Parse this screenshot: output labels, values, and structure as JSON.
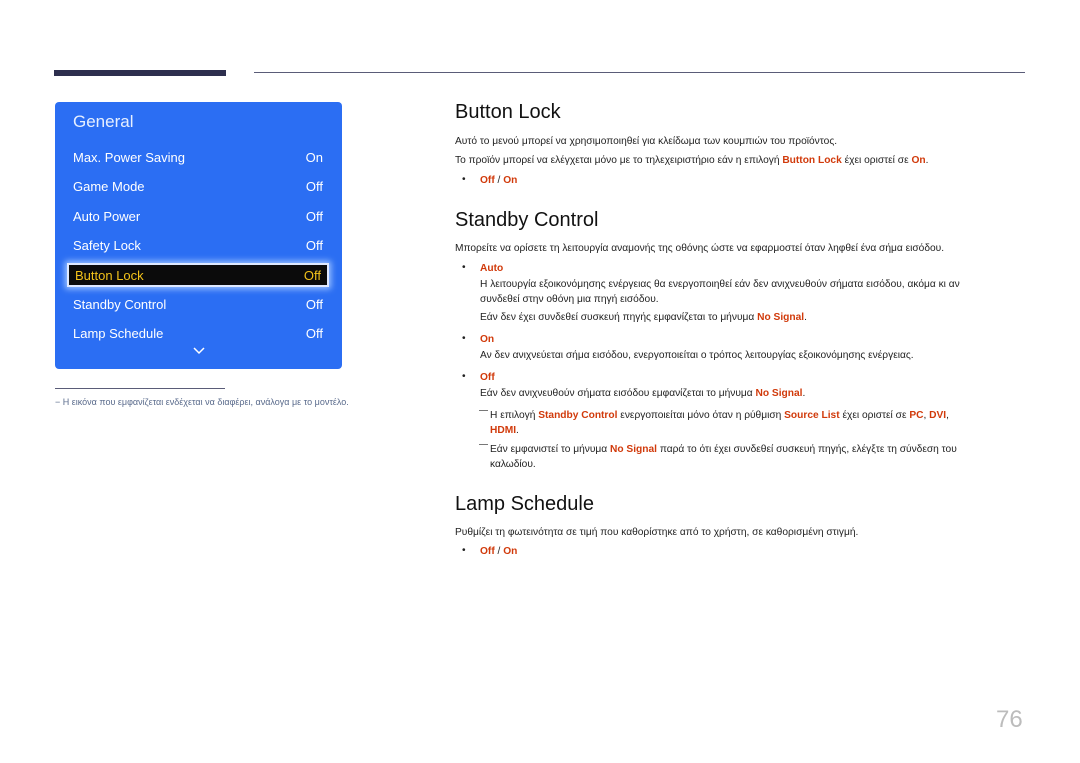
{
  "osd": {
    "title": "General",
    "items": [
      {
        "label": "Max. Power Saving",
        "value": "On"
      },
      {
        "label": "Game Mode",
        "value": "Off"
      },
      {
        "label": "Auto Power",
        "value": "Off"
      },
      {
        "label": "Safety Lock",
        "value": "Off"
      },
      {
        "label": "Button Lock",
        "value": "Off",
        "selected": true
      },
      {
        "label": "Standby Control",
        "value": "Off"
      },
      {
        "label": "Lamp Schedule",
        "value": "Off"
      }
    ],
    "more_icon": "chevron-down-icon",
    "colors": {
      "background": "#2b6ef3",
      "selected_text": "#f2c21a",
      "selected_bg": "#0b0b0b"
    }
  },
  "footnote": "− Η εικόνα που εμφανίζεται ενδέχεται να διαφέρει, ανάλογα με το μοντέλο.",
  "button_lock": {
    "heading": "Button Lock",
    "p1": "Αυτό το μενού μπορεί να χρησιμοποιηθεί για κλείδωμα των κουμπιών του προϊόντος.",
    "p2_before": "Το προϊόν μπορεί να ελέγχεται μόνο με το τηλεχειριστήριο εάν η επιλογή ",
    "p2_hl1": "Button Lock",
    "p2_mid": " έχει οριστεί σε ",
    "p2_hl2": "On",
    "p2_end": ".",
    "options": {
      "a": "Off",
      "sep": " / ",
      "b": "On"
    }
  },
  "standby_control": {
    "heading": "Standby Control",
    "intro": "Μπορείτε να ορίσετε τη λειτουργία αναμονής της οθόνης ώστε να εφαρμοστεί όταν ληφθεί ένα σήμα εισόδου.",
    "auto_label": "Auto",
    "auto_line1": "Η λειτουργία εξοικονόμησης ενέργειας θα ενεργοποιηθεί εάν δεν ανιχνευθούν σήματα εισόδου, ακόμα κι αν",
    "auto_line2": "συνδεθεί στην οθόνη μια πηγή εισόδου.",
    "auto_line3_before": "Εάν δεν έχει συνδεθεί συσκευή πηγής εμφανίζεται το μήνυμα ",
    "auto_line3_hl": "No Signal",
    "auto_line3_end": ".",
    "on_label": "On",
    "on_text": "Αν δεν ανιχνεύεται σήμα εισόδου, ενεργοποιείται ο τρόπος λειτουργίας εξοικονόμησης ενέργειας.",
    "off_label": "Off",
    "off_text_before": "Εάν δεν ανιχνευθούν σήματα εισόδου εμφανίζεται το μήνυμα ",
    "off_text_hl": "No Signal",
    "off_text_end": ".",
    "note1": {
      "t1": "Η επιλογή ",
      "h1": "Standby Control",
      "t2": " ενεργοποιείται μόνο όταν η ρύθμιση ",
      "h2": "Source List",
      "t3": " έχει οριστεί σε ",
      "h3": "PC",
      "t4": ", ",
      "h4": "DVI",
      "t5": ",",
      "h5": "HDMI",
      "t6": "."
    },
    "note2": {
      "t1": "Εάν εμφανιστεί το μήνυμα ",
      "h1": "No Signal",
      "t2": " παρά το ότι έχει συνδεθεί συσκευή πηγής, ελέγξτε τη σύνδεση του",
      "line2": "καλωδίου."
    }
  },
  "lamp_schedule": {
    "heading": "Lamp Schedule",
    "p1": "Ρυθμίζει τη φωτεινότητα σε τιμή που καθορίστηκε από το χρήστη, σε καθορισμένη στιγμή.",
    "options": {
      "a": "Off",
      "sep": " / ",
      "b": "On"
    }
  },
  "bullet_char": "•",
  "page_number": "76",
  "colors": {
    "highlight": "#d13a0b",
    "header_bar": "#2d2f4e"
  }
}
